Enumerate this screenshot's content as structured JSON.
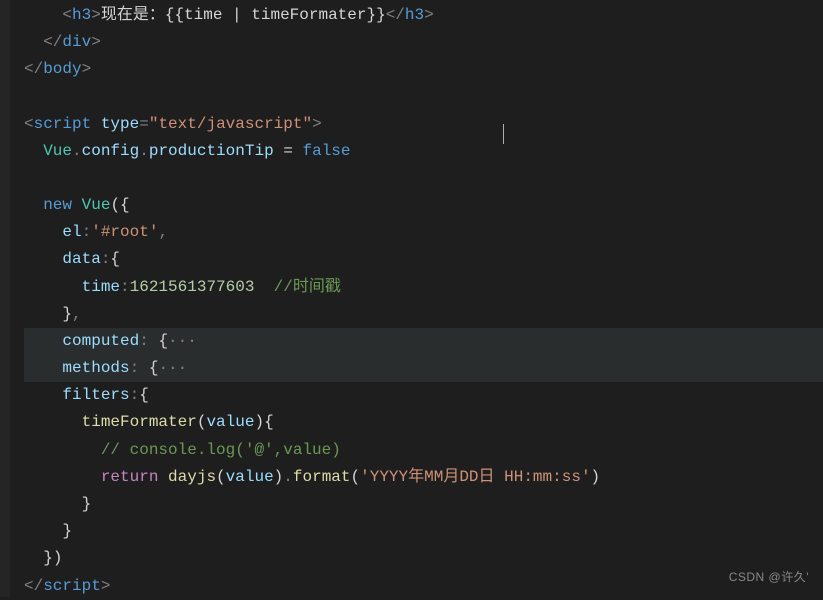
{
  "watermark": "CSDN @许久'",
  "code": {
    "h3_text": "现在是：",
    "h3_expr": "{{time | timeFormater}}",
    "script_type": "text/javascript",
    "vue_config": "Vue",
    "config_prop": "config",
    "productionTip": "productionTip",
    "false_val": "false",
    "new_kw": "new",
    "vue_class": "Vue",
    "el_key": "el",
    "el_val": "'#root'",
    "data_key": "data",
    "time_key": "time",
    "time_val": "1621561377603",
    "time_comment": "//时间戳",
    "computed_key": "computed",
    "methods_key": "methods",
    "filters_key": "filters",
    "timeFormater": "timeFormater",
    "value_param": "value",
    "console_comment": "// console.log('@',value)",
    "return_kw": "return",
    "dayjs": "dayjs",
    "format": "format",
    "format_str": "'YYYY年MM月DD日 HH:mm:ss'",
    "ellipsis": "···"
  }
}
